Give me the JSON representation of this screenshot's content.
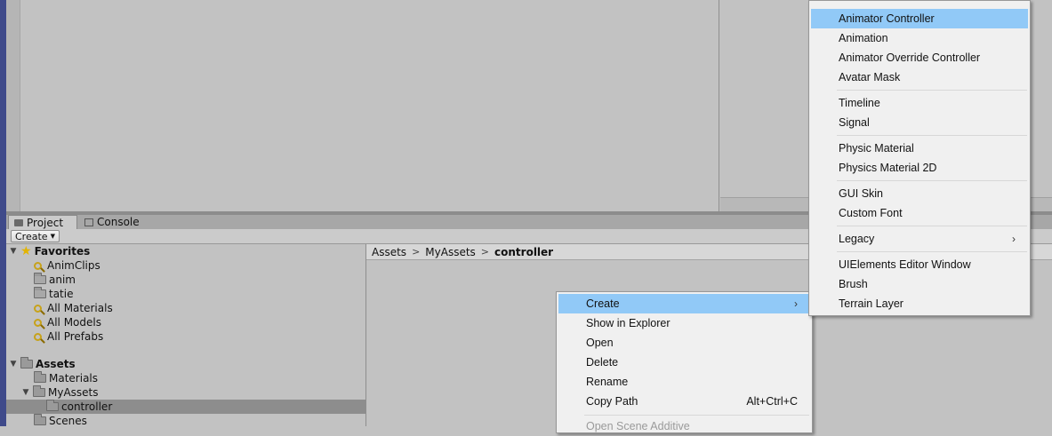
{
  "tabs": {
    "project": "Project",
    "console": "Console"
  },
  "toolbar": {
    "create_label": "Create"
  },
  "tree": {
    "favorites_label": "Favorites",
    "favorites": [
      "AnimClips",
      "anim",
      "tatie",
      "All Materials",
      "All Models",
      "All Prefabs"
    ],
    "assets_label": "Assets",
    "assets": {
      "materials": "Materials",
      "myassets": "MyAssets",
      "controller": "controller",
      "scenes": "Scenes"
    }
  },
  "breadcrumb": [
    "Assets",
    "MyAssets",
    "controller"
  ],
  "context_menu": {
    "items": [
      {
        "label": "Create"
      },
      {
        "label": "Show in Explorer"
      },
      {
        "label": "Open"
      },
      {
        "label": "Delete"
      },
      {
        "label": "Rename"
      },
      {
        "label": "Copy Path",
        "shortcut": "Alt+Ctrl+C"
      },
      {
        "label": "Open Scene Additive"
      }
    ]
  },
  "create_submenu": {
    "items": [
      "Animator Controller",
      "Animation",
      "Animator Override Controller",
      "Avatar Mask",
      "Timeline",
      "Signal",
      "Physic Material",
      "Physics Material 2D",
      "GUI Skin",
      "Custom Font",
      "Legacy",
      "UIElements Editor Window",
      "Brush",
      "Terrain Layer"
    ]
  },
  "colors": {
    "highlight": "#91c9f7",
    "panel": "#c2c2c2",
    "menu_bg": "#f0f0f0",
    "selection_row": "#8d8d8d"
  },
  "icons": {
    "favorites": "star-icon",
    "saved_search": "search-icon",
    "folder": "folder-icon",
    "submenu": "chevron-right-icon"
  }
}
